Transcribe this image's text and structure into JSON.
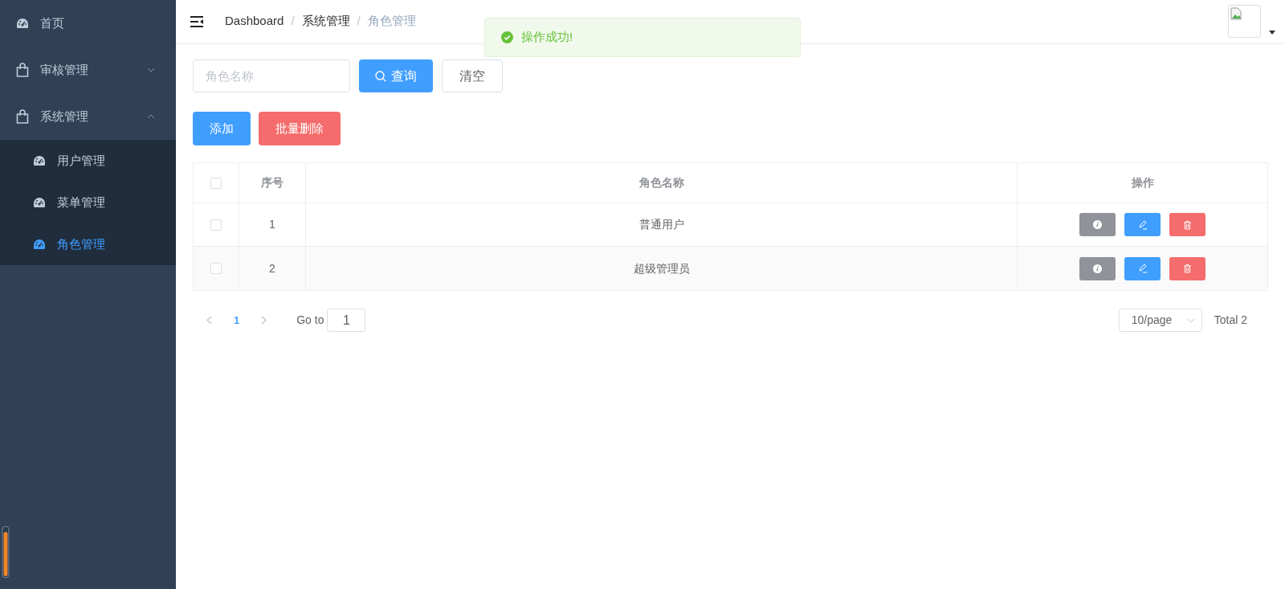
{
  "sidebar": {
    "items": [
      {
        "label": "首页",
        "selected": false
      },
      {
        "label": "审核管理",
        "selected": false,
        "expanded": false
      },
      {
        "label": "系统管理",
        "selected": false,
        "expanded": true,
        "children": [
          {
            "label": "用户管理",
            "selected": false
          },
          {
            "label": "菜单管理",
            "selected": false
          },
          {
            "label": "角色管理",
            "selected": true
          }
        ]
      }
    ]
  },
  "breadcrumb": {
    "separator": "/",
    "items": [
      "Dashboard",
      "系统管理",
      "角色管理"
    ]
  },
  "toast": {
    "kind": "success",
    "message": "操作成功!"
  },
  "search": {
    "placeholder": "角色名称",
    "query_button": "查询",
    "clear_button": "清空"
  },
  "actions": [
    {
      "label": "添加",
      "kind": "primary"
    },
    {
      "label": "批量删除",
      "kind": "danger"
    }
  ],
  "table": {
    "columns": [
      "序号",
      "角色名称",
      "操作"
    ],
    "all_checked": false,
    "rows": [
      {
        "index": "1",
        "name": "普通用户",
        "checked": false
      },
      {
        "index": "2",
        "name": "超级管理员",
        "checked": false
      }
    ]
  },
  "pagination": {
    "pages": [
      {
        "label": "1",
        "selected": true
      }
    ],
    "goto_label": "Go to",
    "goto_value": "1",
    "page_size": "10/page",
    "total": "Total 2"
  }
}
